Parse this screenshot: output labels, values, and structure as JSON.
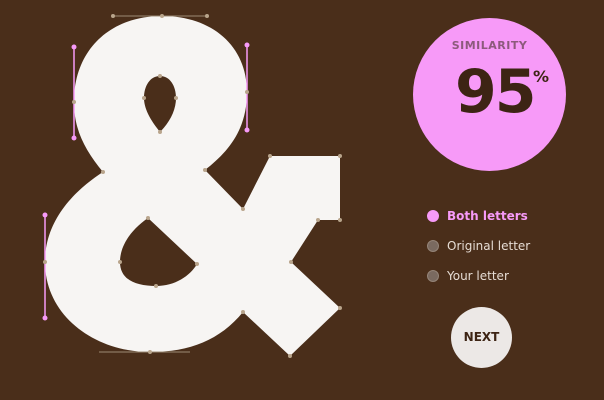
{
  "glyph": {
    "character": "&",
    "fill": "#f7f5f3"
  },
  "similarity": {
    "label": "SIMILARITY",
    "value": "95",
    "unit": "%"
  },
  "options": [
    {
      "label": "Both letters",
      "selected": true
    },
    {
      "label": "Original letter",
      "selected": false
    },
    {
      "label": "Your letter",
      "selected": false
    }
  ],
  "next_label": "NEXT",
  "colors": {
    "background": "#4a2e1a",
    "accent": "#f79af8",
    "control_point": "#b9a58c",
    "control_line": "#9c8b74"
  }
}
